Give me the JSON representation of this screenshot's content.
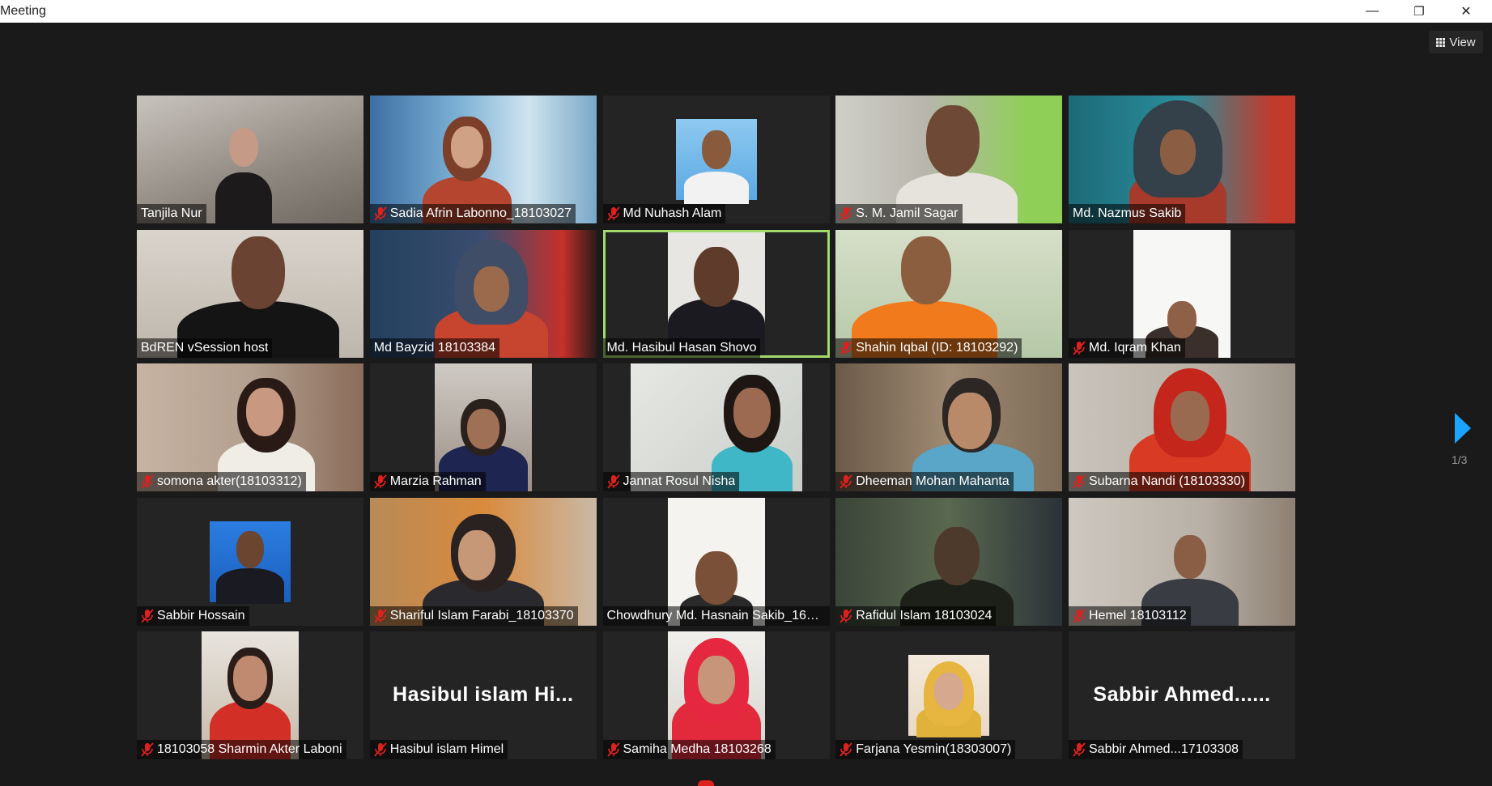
{
  "window": {
    "title": "Meeting",
    "minimize": "—",
    "restore": "❐",
    "close": "✕"
  },
  "toolbar": {
    "view_label": "View"
  },
  "pagination": {
    "indicator": "1/3"
  },
  "colors": {
    "active_speaker": "#a3d96c",
    "mute": "#e0201c",
    "arrow": "#1aa3ff"
  },
  "participants": [
    {
      "name": "Tanjila Nur",
      "muted": false
    },
    {
      "name": "Sadia Afrin Labonno_18103027",
      "muted": true
    },
    {
      "name": "Md Nuhash Alam",
      "muted": true
    },
    {
      "name": "S. M. Jamil Sagar",
      "muted": true
    },
    {
      "name": "Md. Nazmus Sakib",
      "muted": false
    },
    {
      "name": "BdREN vSession host",
      "muted": false
    },
    {
      "name": "Md Bayzid 18103384",
      "muted": false
    },
    {
      "name": "Md. Hasibul Hasan Shovo",
      "muted": false,
      "active": true
    },
    {
      "name": "Shahin Iqbal (ID: 18103292)",
      "muted": true
    },
    {
      "name": "Md. Iqram Khan",
      "muted": true
    },
    {
      "name": "somona akter(18103312)",
      "muted": true
    },
    {
      "name": "Marzia Rahman",
      "muted": true
    },
    {
      "name": "Jannat Rosul Nisha",
      "muted": true
    },
    {
      "name": "Dheeman Mohan Mahanta",
      "muted": true
    },
    {
      "name": "Subarna Nandi (18103330)",
      "muted": true
    },
    {
      "name": "Sabbir Hossain",
      "muted": true
    },
    {
      "name": "Shariful Islam Farabi_18103370",
      "muted": true
    },
    {
      "name": "Chowdhury Md. Hasnain Sakib_1610...",
      "muted": false
    },
    {
      "name": "Rafidul  Islam 18103024",
      "muted": true
    },
    {
      "name": "Hemel 18103112",
      "muted": true
    },
    {
      "name": "18103058 Sharmin Akter Laboni",
      "muted": true
    },
    {
      "name": "Hasibul islam Himel",
      "muted": true,
      "display_text": "Hasibul  islam  Hi..."
    },
    {
      "name": "Samiha Medha 18103268",
      "muted": true
    },
    {
      "name": "Farjana Yesmin(18303007)",
      "muted": true
    },
    {
      "name": "Sabbir Ahmed...17103308",
      "muted": true,
      "display_text": "Sabbir  Ahmed......"
    }
  ]
}
